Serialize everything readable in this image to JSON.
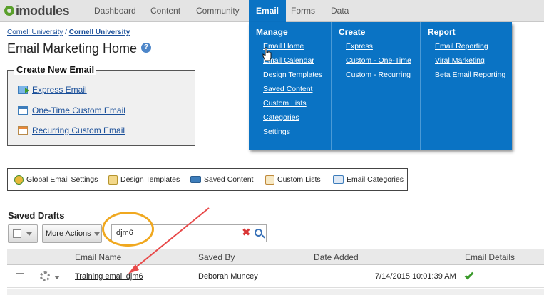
{
  "nav": {
    "logo": "imodules",
    "items": [
      "Dashboard",
      "Content",
      "Community",
      "Email",
      "Forms",
      "Data"
    ],
    "active": "Email"
  },
  "breadcrumb": [
    "Cornell University",
    "Cornell University"
  ],
  "breadcrumb_sep": " / ",
  "page_title": "Email Marketing Home",
  "help_icon": "?",
  "create_box": {
    "title": "Create New Email",
    "links": [
      "Express Email",
      "One-Time Custom Email",
      "Recurring Custom Email"
    ]
  },
  "toolbar": [
    "Global Email Settings",
    "Design Templates",
    "Saved Content",
    "Custom Lists",
    "Email Categories"
  ],
  "drafts": {
    "title": "Saved Drafts",
    "more_actions": "More Actions",
    "search_value": "djm6",
    "columns": [
      "Email Name",
      "Saved By",
      "Date Added",
      "Email Details"
    ],
    "rows": [
      {
        "name": "Training email djm6",
        "saved_by": "Deborah Muncey",
        "date_added": "7/14/2015 10:01:39 AM"
      }
    ]
  },
  "menu": {
    "manage": {
      "title": "Manage",
      "items": [
        "Email Home",
        "Email Calendar",
        "Design Templates",
        "Saved Content",
        "Custom Lists",
        "Categories",
        "Settings"
      ]
    },
    "create": {
      "title": "Create",
      "items": [
        "Express",
        "Custom - One-Time",
        "Custom - Recurring"
      ]
    },
    "report": {
      "title": "Report",
      "items": [
        "Email Reporting",
        "Viral Marketing",
        "Beta Email Reporting"
      ]
    }
  },
  "colors": {
    "menu_bg": "#0a73c4",
    "link": "#1a4f99",
    "highlight": "#f0a81f",
    "arrow": "#e84a4a"
  },
  "icons": [
    "search-icon",
    "clear-icon",
    "gear-icon",
    "checkmark-icon",
    "help-icon",
    "pointer-cursor-icon"
  ]
}
